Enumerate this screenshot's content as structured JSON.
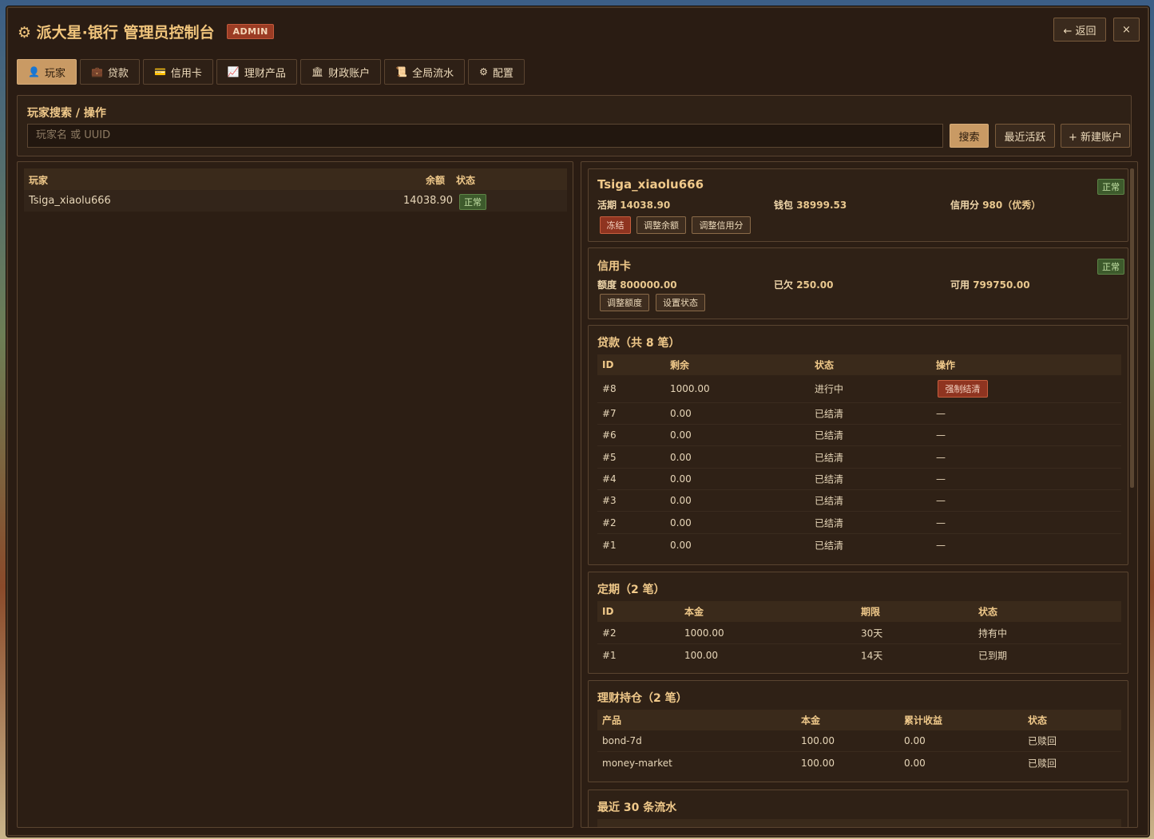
{
  "window": {
    "title": "⚙ 派大星·银行 管理员控制台",
    "admin_badge": "ADMIN",
    "back_label": "← 返回",
    "close_label": "×"
  },
  "tabs": [
    {
      "icon": "👤",
      "label": "玩家"
    },
    {
      "icon": "💼",
      "label": "贷款"
    },
    {
      "icon": "💳",
      "label": "信用卡"
    },
    {
      "icon": "📈",
      "label": "理财产品"
    },
    {
      "icon": "🏛",
      "label": "财政账户"
    },
    {
      "icon": "📜",
      "label": "全局流水"
    },
    {
      "icon": "⚙",
      "label": "配置"
    }
  ],
  "search": {
    "title": "玩家搜索 / 操作",
    "placeholder": "玩家名 或 UUID",
    "search_label": "搜索",
    "recent_label": "最近活跃",
    "new_label": "+ 新建账户"
  },
  "player_list": {
    "headers": {
      "player": "玩家",
      "balance": "余额",
      "status": "状态"
    },
    "rows": [
      {
        "name": "Tsiga_xiaolu666",
        "balance": "14038.90",
        "status": "正常"
      }
    ]
  },
  "account": {
    "name": "Tsiga_xiaolu666",
    "status": "正常",
    "current_label": "活期",
    "current_value": "14038.90",
    "wallet_label": "钱包",
    "wallet_value": "38999.53",
    "credit_label": "信用分",
    "credit_value": "980（优秀）",
    "freeze_label": "冻结",
    "adjust_balance_label": "调整余额",
    "adjust_credit_label": "调整信用分"
  },
  "credit_card": {
    "title": "信用卡",
    "status": "正常",
    "limit_label": "额度",
    "limit_value": "800000.00",
    "owed_label": "已欠",
    "owed_value": "250.00",
    "available_label": "可用",
    "available_value": "799750.00",
    "adjust_limit_label": "调整额度",
    "set_status_label": "设置状态"
  },
  "loans": {
    "title": "贷款（共 8 笔）",
    "headers": {
      "id": "ID",
      "remaining": "剩余",
      "status": "状态",
      "action": "操作"
    },
    "force_label": "强制结清",
    "rows": [
      {
        "id": "#8",
        "remaining": "1000.00",
        "status": "进行中",
        "action": ""
      },
      {
        "id": "#7",
        "remaining": "0.00",
        "status": "已结清",
        "action": "—"
      },
      {
        "id": "#6",
        "remaining": "0.00",
        "status": "已结清",
        "action": "—"
      },
      {
        "id": "#5",
        "remaining": "0.00",
        "status": "已结清",
        "action": "—"
      },
      {
        "id": "#4",
        "remaining": "0.00",
        "status": "已结清",
        "action": "—"
      },
      {
        "id": "#3",
        "remaining": "0.00",
        "status": "已结清",
        "action": "—"
      },
      {
        "id": "#2",
        "remaining": "0.00",
        "status": "已结清",
        "action": "—"
      },
      {
        "id": "#1",
        "remaining": "0.00",
        "status": "已结清",
        "action": "—"
      }
    ]
  },
  "fixed": {
    "title": "定期（2 笔）",
    "headers": {
      "id": "ID",
      "principal": "本金",
      "term": "期限",
      "status": "状态"
    },
    "rows": [
      {
        "id": "#2",
        "principal": "1000.00",
        "term": "30天",
        "status": "持有中"
      },
      {
        "id": "#1",
        "principal": "100.00",
        "term": "14天",
        "status": "已到期"
      }
    ]
  },
  "wealth": {
    "title": "理财持仓（2 笔）",
    "headers": {
      "product": "产品",
      "principal": "本金",
      "income": "累计收益",
      "status": "状态"
    },
    "rows": [
      {
        "product": "bond-7d",
        "principal": "100.00",
        "income": "0.00",
        "status": "已赎回"
      },
      {
        "product": "money-market",
        "principal": "100.00",
        "income": "0.00",
        "status": "已赎回"
      }
    ]
  },
  "recent": {
    "title": "最近 30 条流水"
  }
}
